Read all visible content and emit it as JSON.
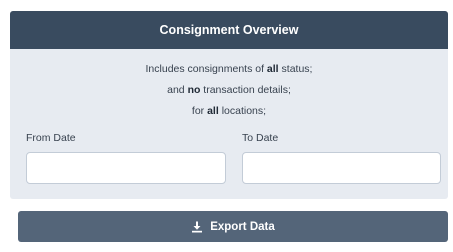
{
  "panel": {
    "title": "Consignment Overview",
    "description": [
      {
        "pre": "Includes consignments of ",
        "bold": "all",
        "post": " status;"
      },
      {
        "pre": "and ",
        "bold": "no",
        "post": " transaction details;"
      },
      {
        "pre": "for ",
        "bold": "all",
        "post": " locations;"
      }
    ],
    "from_date": {
      "label": "From Date",
      "value": "",
      "placeholder": ""
    },
    "to_date": {
      "label": "To Date",
      "value": "",
      "placeholder": ""
    }
  },
  "export_button": {
    "label": "Export Data",
    "icon": "download-icon"
  },
  "colors": {
    "header_bg": "#394b5f",
    "panel_bg": "#e7ebf1",
    "button_bg": "#546579"
  }
}
